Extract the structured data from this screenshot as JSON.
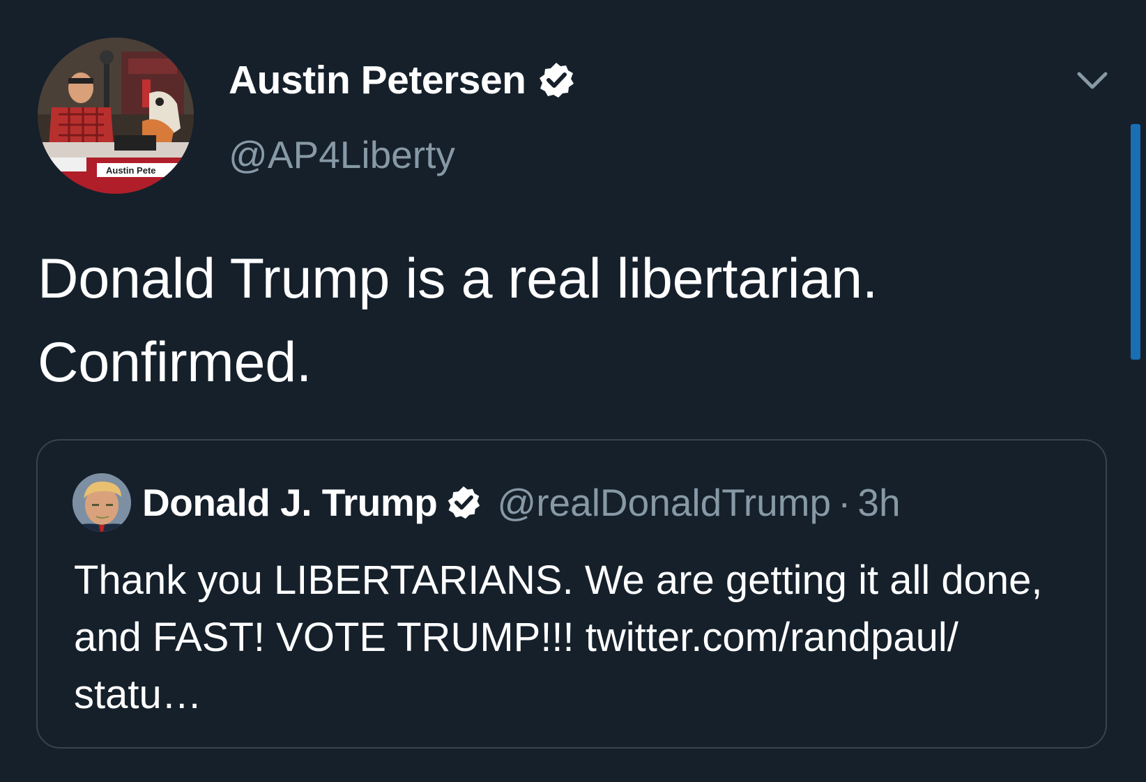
{
  "tweet": {
    "author": {
      "name": "Austin Petersen",
      "handle": "@AP4Liberty",
      "verified": true,
      "avatar_caption": "Austin Pete"
    },
    "text_line1": "Donald Trump is a real libertarian.",
    "text_line2": "Confirmed.",
    "menu_icon": "chevron-down-icon"
  },
  "quoted_tweet": {
    "author_name": "Donald J. Trump",
    "handle": "@realDonaldTrump",
    "separator": "·",
    "time": "3h",
    "verified": true,
    "text": "Thank you LIBERTARIANS. We are getting it all done, and FAST! VOTE TRUMP!!! twitter.com/randpaul/ statu…"
  },
  "colors": {
    "background": "#15202b",
    "text_primary": "#ffffff",
    "text_secondary": "#8899a6",
    "border": "#38444d",
    "scrollbar": "#1a6fb3"
  }
}
